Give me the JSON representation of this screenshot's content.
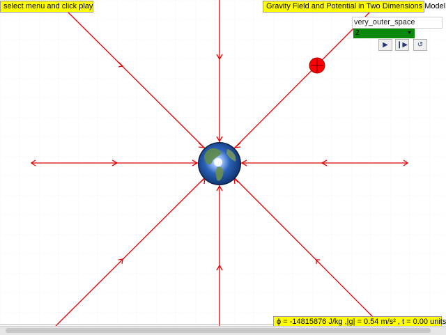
{
  "header": {
    "menu_hint": "select menu and click play",
    "title": "Gravity Field and Potential in Two Dimensions Model"
  },
  "controls": {
    "world_selected": "very_outer_space",
    "speed_selected": "2",
    "play_icon": "play-icon",
    "step_icon": "step-forward-icon",
    "reset_icon": "reset-icon"
  },
  "status": {
    "readout": "ϕ = -14815876 J/kg ,|g| = 0.54 m/s² , t = 0.00 units"
  },
  "colors": {
    "field_line": "#e00000",
    "label_bg": "#ffff00",
    "probe": "#ff0000",
    "earth_ocean": "#1f5fb8",
    "speed_bg": "#0a8a0a"
  }
}
